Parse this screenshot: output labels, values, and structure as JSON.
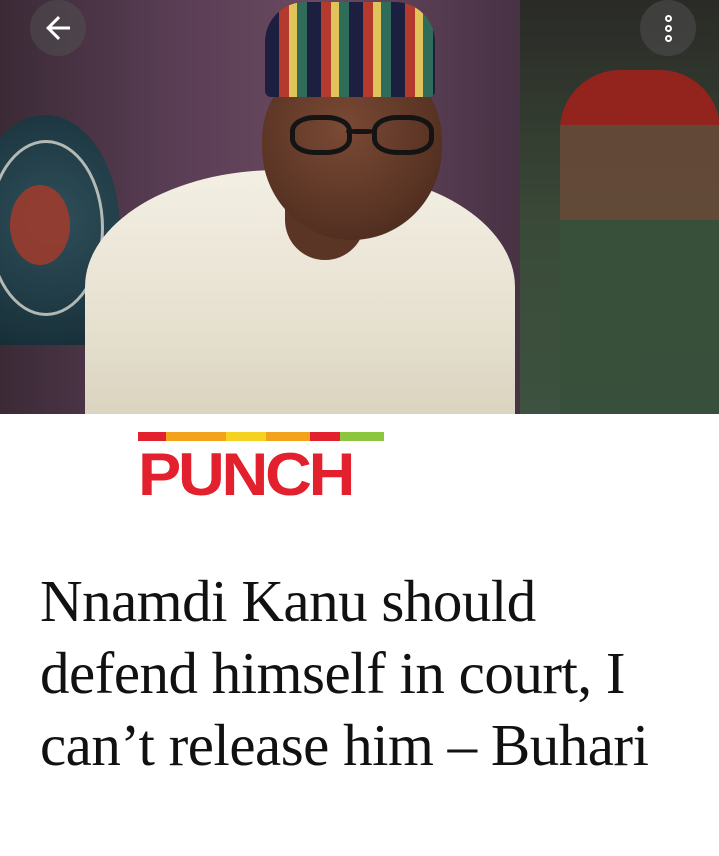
{
  "header": {
    "back_icon": "arrow-left-icon",
    "more_icon": "more-vertical-icon"
  },
  "hero_image": {
    "description_icon": "photo"
  },
  "publisher": {
    "logo_text": "PUNCH",
    "logo_color": "#e3202d",
    "stripe_colors": [
      "#e3202d",
      "#f2a21b",
      "#f5d21f",
      "#f2a21b",
      "#e3202d",
      "#8cc63f"
    ]
  },
  "article": {
    "headline": "Nnamdi Kanu should defend himself in court, I can’t release him – Buhari"
  }
}
